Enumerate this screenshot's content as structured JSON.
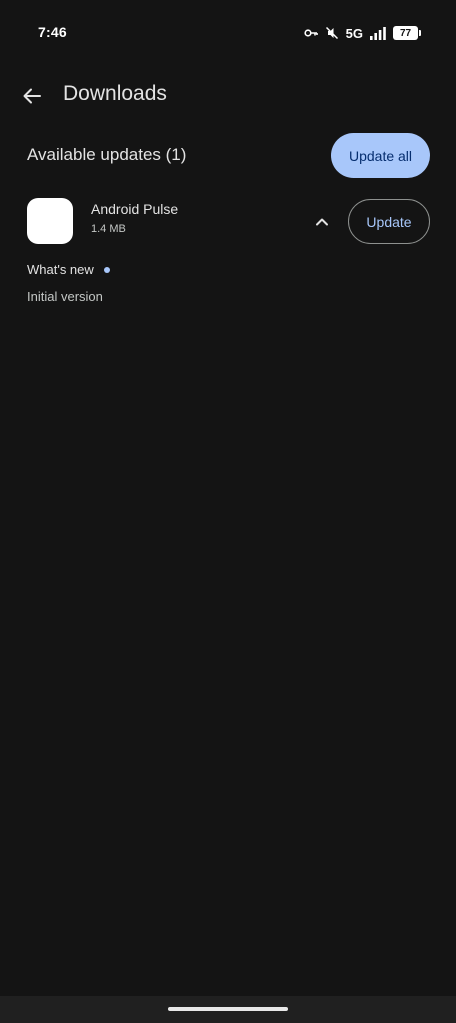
{
  "status_bar": {
    "time": "7:46",
    "network": "5G",
    "battery": "77",
    "icons": [
      "vpn-key-icon",
      "vibrate-off-icon",
      "signal-icon",
      "battery-icon"
    ]
  },
  "app_bar": {
    "back_icon": "arrow-back-icon",
    "title": "Downloads"
  },
  "updates": {
    "section_title": "Available updates (1)",
    "update_all_label": "Update all",
    "items": [
      {
        "name": "Android Pulse",
        "size": "1.4 MB",
        "update_label": "Update",
        "expanded": true,
        "whats_new_label": "What's new",
        "release_notes": "Initial version"
      }
    ]
  },
  "colors": {
    "background": "#141414",
    "accent": "#a8c7fa",
    "on_accent": "#062e6f",
    "outline": "#8e918f"
  }
}
